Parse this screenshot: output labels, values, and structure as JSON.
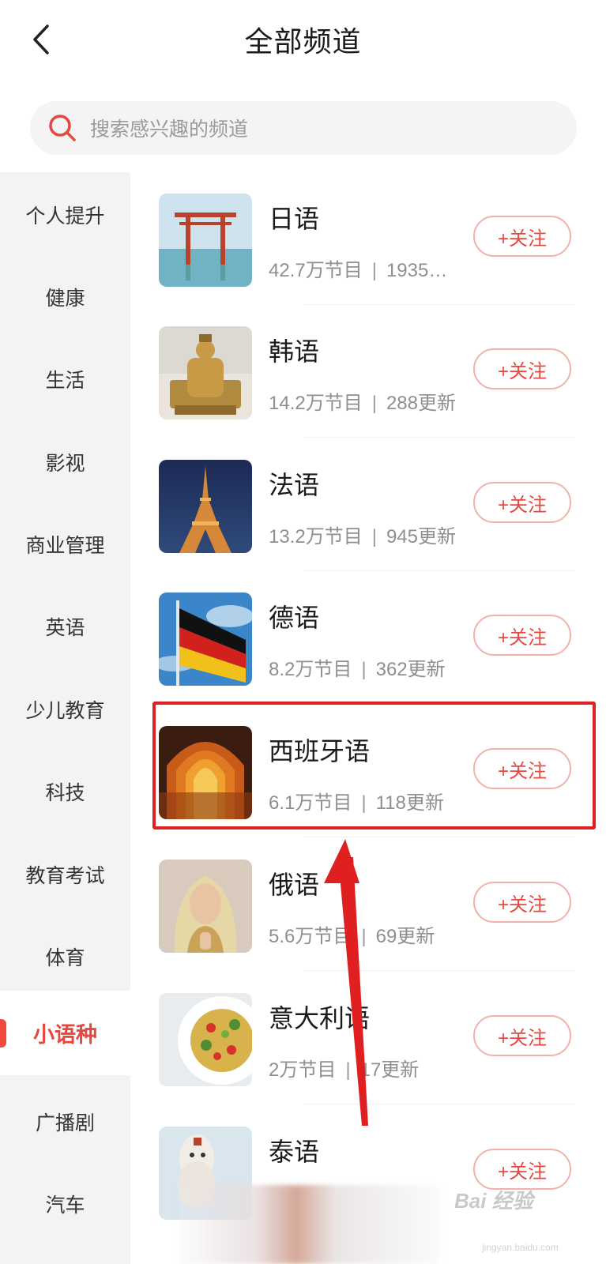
{
  "header": {
    "title": "全部频道"
  },
  "search": {
    "placeholder": "搜索感兴趣的频道"
  },
  "sidebar": {
    "items": [
      {
        "label": "个人提升",
        "active": false
      },
      {
        "label": "健康",
        "active": false
      },
      {
        "label": "生活",
        "active": false
      },
      {
        "label": "影视",
        "active": false
      },
      {
        "label": "商业管理",
        "active": false
      },
      {
        "label": "英语",
        "active": false
      },
      {
        "label": "少儿教育",
        "active": false
      },
      {
        "label": "科技",
        "active": false
      },
      {
        "label": "教育考试",
        "active": false
      },
      {
        "label": "体育",
        "active": false
      },
      {
        "label": "小语种",
        "active": true
      },
      {
        "label": "广播剧",
        "active": false
      },
      {
        "label": "汽车",
        "active": false
      }
    ]
  },
  "channels": [
    {
      "name": "日语",
      "programs": "42.7万节目",
      "updates": "1935…",
      "follow": "+关注",
      "image": "torii-gate-image"
    },
    {
      "name": "韩语",
      "programs": "14.2万节目",
      "updates": "288更新",
      "follow": "+关注",
      "image": "golden-statue-image"
    },
    {
      "name": "法语",
      "programs": "13.2万节目",
      "updates": "945更新",
      "follow": "+关注",
      "image": "eiffel-tower-image"
    },
    {
      "name": "德语",
      "programs": "8.2万节目",
      "updates": "362更新",
      "follow": "+关注",
      "image": "german-flag-image"
    },
    {
      "name": "西班牙语",
      "programs": "6.1万节目",
      "updates": "118更新",
      "follow": "+关注",
      "image": "arches-image"
    },
    {
      "name": "俄语",
      "programs": "5.6万节目",
      "updates": "69更新",
      "follow": "+关注",
      "image": "madonna-image"
    },
    {
      "name": "意大利语",
      "programs": "2万节目",
      "updates": "17更新",
      "follow": "+关注",
      "image": "pasta-image"
    },
    {
      "name": "泰语",
      "programs": "",
      "updates": "",
      "follow": "+关注",
      "image": "thai-mask-image"
    }
  ],
  "annotation": {
    "highlighted_channel": "西班牙语",
    "color": "#e02020"
  },
  "watermark": {
    "text": "Bai 经验",
    "sub": "jingyan.baidu.com"
  },
  "colors": {
    "accent": "#e8473f",
    "sidebar_bg": "#f3f3f5"
  }
}
